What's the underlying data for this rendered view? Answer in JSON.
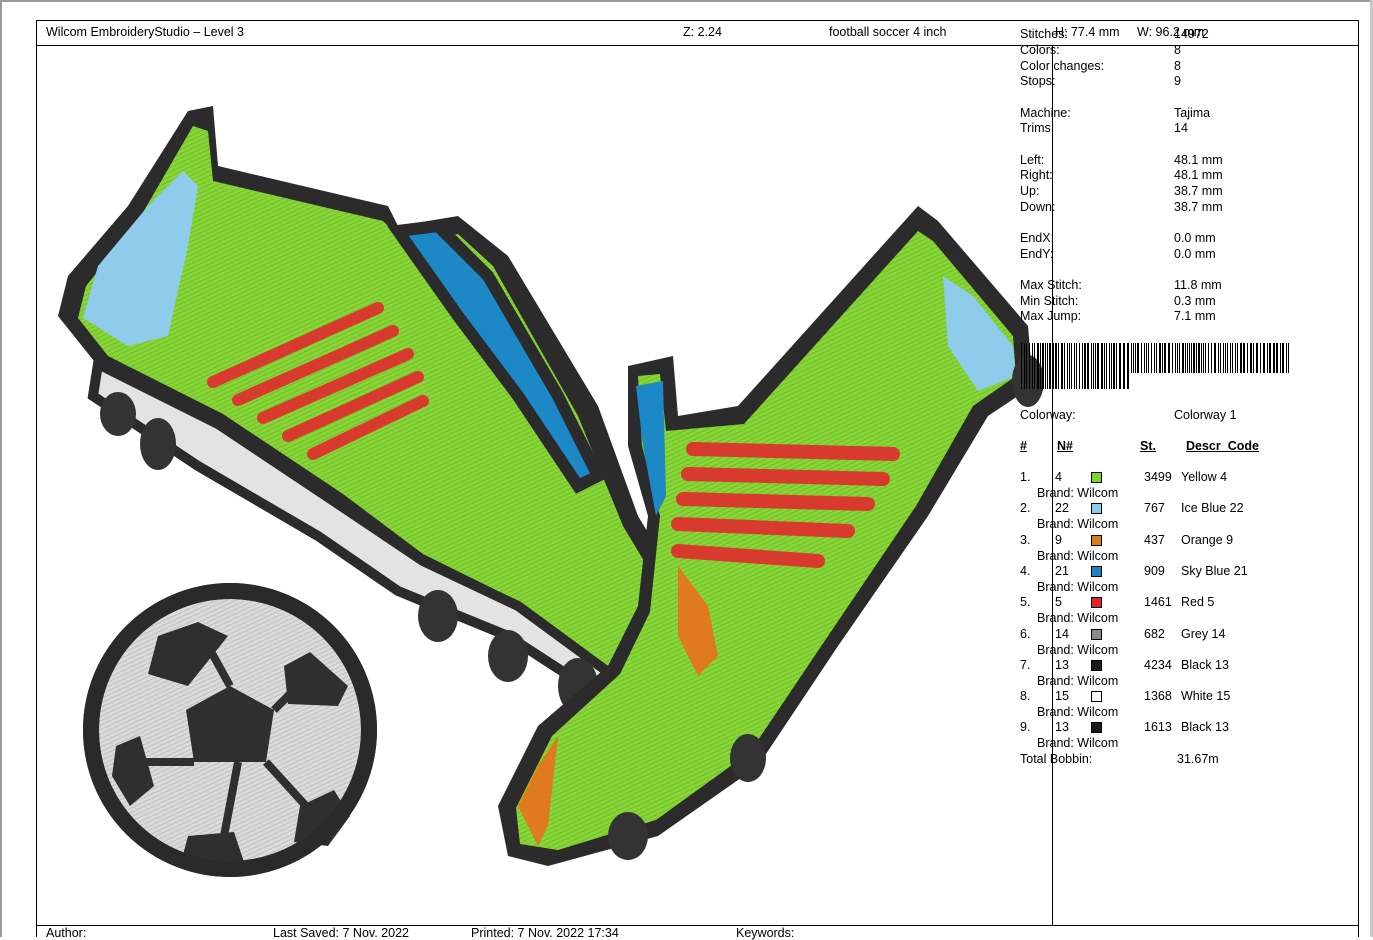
{
  "header": {
    "app_title": "Wilcom EmbroideryStudio – Level 3",
    "zoom": "Z: 2.24",
    "design_name": "football soccer 4 inch",
    "height": "H: 77.4 mm",
    "width": "W: 96.2 mm"
  },
  "stats": [
    {
      "label": "Stitches:",
      "value": "14972"
    },
    {
      "label": "Colors:",
      "value": "8"
    },
    {
      "label": "Color changes:",
      "value": "8"
    },
    {
      "label": "Stops:",
      "value": "9"
    },
    {
      "label": "Machine:",
      "value": "Tajima"
    },
    {
      "label": "Trims:",
      "value": "14"
    },
    {
      "label": "Left:",
      "value": "48.1 mm"
    },
    {
      "label": "Right:",
      "value": "48.1 mm"
    },
    {
      "label": "Up:",
      "value": "38.7 mm"
    },
    {
      "label": "Down:",
      "value": "38.7 mm"
    },
    {
      "label": "EndX:",
      "value": "0.0 mm"
    },
    {
      "label": "EndY:",
      "value": "0.0 mm"
    },
    {
      "label": "Max Stitch:",
      "value": "11.8 mm"
    },
    {
      "label": "Min Stitch:",
      "value": "0.3 mm"
    },
    {
      "label": "Max Jump:",
      "value": "7.1 mm"
    }
  ],
  "colorway": {
    "label": "Colorway:",
    "value": "Colorway 1"
  },
  "thread_table": {
    "headers": {
      "index": "#",
      "number": "N#",
      "stitches": "St.",
      "descr": "Descr_Code"
    },
    "rows": [
      {
        "index": "1.",
        "number": "4",
        "color": "#7bd62c",
        "stitches": "3499",
        "descr": "Yellow 4",
        "brand": "Brand: Wilcom"
      },
      {
        "index": "2.",
        "number": "22",
        "color": "#8fcbea",
        "stitches": "767",
        "descr": "Ice Blue 22",
        "brand": "Brand: Wilcom"
      },
      {
        "index": "3.",
        "number": "9",
        "color": "#e07a1f",
        "stitches": "437",
        "descr": "Orange 9",
        "brand": "Brand: Wilcom"
      },
      {
        "index": "4.",
        "number": "21",
        "color": "#1a83c4",
        "stitches": "909",
        "descr": "Sky Blue 21",
        "brand": "Brand: Wilcom"
      },
      {
        "index": "5.",
        "number": "5",
        "color": "#e02323",
        "stitches": "1461",
        "descr": "Red 5",
        "brand": "Brand: Wilcom"
      },
      {
        "index": "6.",
        "number": "14",
        "color": "#8a8a8a",
        "stitches": "682",
        "descr": "Grey 14",
        "brand": "Brand: Wilcom"
      },
      {
        "index": "7.",
        "number": "13",
        "color": "#1a1a1a",
        "stitches": "4234",
        "descr": "Black 13",
        "brand": "Brand: Wilcom"
      },
      {
        "index": "8.",
        "number": "15",
        "color": "#ffffff",
        "stitches": "1368",
        "descr": "White 15",
        "brand": "Brand: Wilcom"
      },
      {
        "index": "9.",
        "number": "13",
        "color": "#1a1a1a",
        "stitches": "1613",
        "descr": "Black 13",
        "brand": "Brand: Wilcom"
      }
    ]
  },
  "total_bobbin": {
    "label": "Total Bobbin:",
    "value": "31.67m"
  },
  "footer": {
    "author": "Author:",
    "last_saved": "Last Saved:  7 Nov. 2022",
    "printed": "Printed:  7 Nov. 2022 17:34",
    "keywords": "Keywords:"
  }
}
